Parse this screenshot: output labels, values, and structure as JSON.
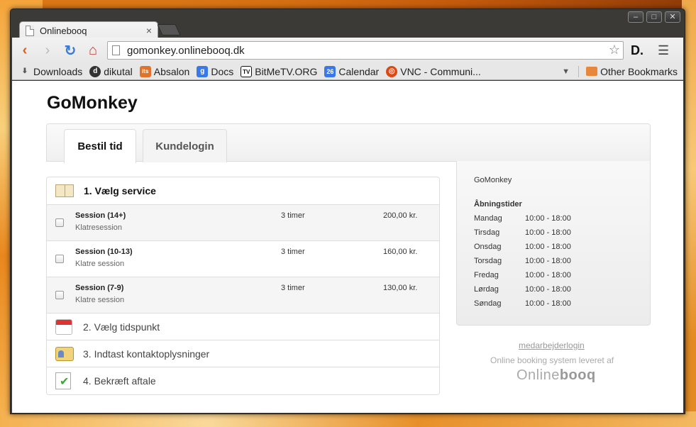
{
  "browser": {
    "tab_title": "Onlinebooq",
    "url": "gomonkey.onlinebooq.dk",
    "bookmarks": [
      {
        "label": "Downloads",
        "icon": "download-icon",
        "color": "#555555"
      },
      {
        "label": "dikutal",
        "icon": "dikutal-icon",
        "color": "#333333"
      },
      {
        "label": "Absalon",
        "icon": "its-icon",
        "color": "#e0732b"
      },
      {
        "label": "Docs",
        "icon": "google-icon",
        "color": "#3b78e7"
      },
      {
        "label": "BitMeTV.ORG",
        "icon": "tv-icon",
        "color": "#222222"
      },
      {
        "label": "Calendar",
        "icon": "calendar-icon",
        "color": "#3b78e7"
      },
      {
        "label": "VNC - Communi...",
        "icon": "ubuntu-icon",
        "color": "#dd4814"
      }
    ],
    "other_bookmarks": "Other Bookmarks"
  },
  "page": {
    "title": "GoMonkey",
    "tabs": [
      {
        "label": "Bestil tid",
        "active": true
      },
      {
        "label": "Kundelogin",
        "active": false
      }
    ],
    "step1": "1. Vælg service",
    "services": [
      {
        "name": "Session (14+)",
        "desc": "Klatresession",
        "duration": "3 timer",
        "price": "200,00 kr."
      },
      {
        "name": "Session (10-13)",
        "desc": "Klatre session",
        "duration": "3 timer",
        "price": "160,00 kr."
      },
      {
        "name": "Session (7-9)",
        "desc": "Klatre session",
        "duration": "3 timer",
        "price": "130,00 kr."
      }
    ],
    "step2": "2. Vælg tidspunkt",
    "step3": "3. Indtast kontaktoplysninger",
    "step4": "4. Bekræft aftale"
  },
  "sidebar": {
    "company": "GoMonkey",
    "hours_title": "Åbningstider",
    "hours": [
      {
        "day": "Mandag",
        "time": "10:00 - 18:00"
      },
      {
        "day": "Tirsdag",
        "time": "10:00 - 18:00"
      },
      {
        "day": "Onsdag",
        "time": "10:00 - 18:00"
      },
      {
        "day": "Torsdag",
        "time": "10:00 - 18:00"
      },
      {
        "day": "Fredag",
        "time": "10:00 - 18:00"
      },
      {
        "day": "Lørdag",
        "time": "10:00 - 18:00"
      },
      {
        "day": "Søndag",
        "time": "10:00 - 18:00"
      }
    ]
  },
  "footer": {
    "staff_login": "medarbejderlogin",
    "tagline": "Online booking system leveret af",
    "logo_light": "Online",
    "logo_bold": "booq"
  }
}
